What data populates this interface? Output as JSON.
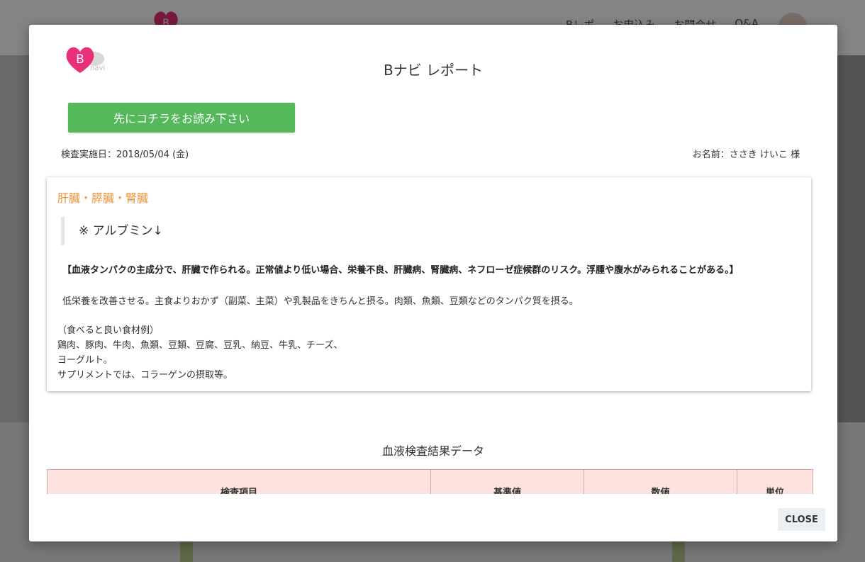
{
  "background": {
    "nav": [
      "Bレポ",
      "お申込み",
      "お問合せ",
      "Q&A"
    ]
  },
  "logo": {
    "letter": "B",
    "text": "navi"
  },
  "modal": {
    "title": "Bナビ レポート",
    "read_first_label": "先にコチラをお読み下さい",
    "exam_date_label": "検査実施日：",
    "exam_date": "2018/05/04 (金)",
    "name_label": "お名前：",
    "name": "ささき けいこ 様",
    "card": {
      "title": "肝臓・膵臓・腎臓",
      "item": "※ アルブミン↓",
      "description": "【血液タンパクの主成分で、肝臓で作られる。正常値より低い場合、栄養不良、肝臓病、腎臓病、ネフローゼ症候群のリスク。浮腫や腹水がみられることがある。】",
      "advice": "低栄養を改善させる。主食よりおかず（副菜、主菜）や乳製品をきちんと摂る。肉類、魚類、豆類などのタンパク質を摂る。",
      "foods_heading": "（食べると良い食材例）",
      "foods_line1": "鶏肉、豚肉、牛肉、魚類、豆類、豆腐、豆乳、納豆、牛乳、チーズ、",
      "foods_line2": "ヨーグルト。",
      "supplement": "サプリメントでは、コラーゲンの摂取等。"
    },
    "results_title": "血液検査結果データ",
    "table_headers": [
      "検査項目",
      "基準値",
      "数値",
      "単位"
    ],
    "close_label": "CLOSE"
  },
  "colors": {
    "accent_green": "#55b95b",
    "card_title_orange": "#f0923a",
    "table_header_bg": "#fde2df",
    "logo_pink": "#e8317a"
  }
}
